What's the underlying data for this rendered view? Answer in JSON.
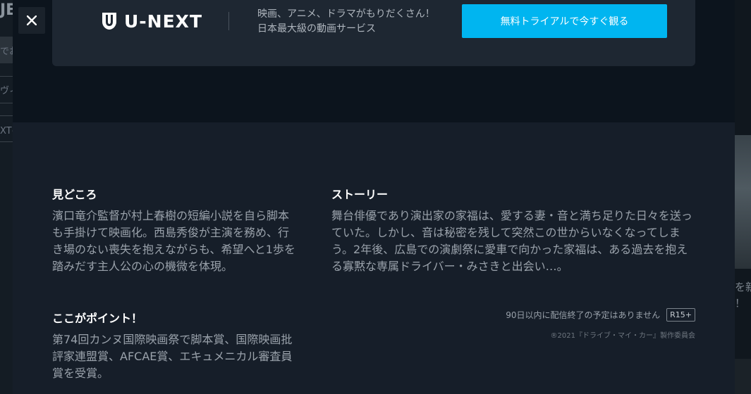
{
  "background": {
    "left_fragments": [
      "JE",
      "でお",
      "ヴィ",
      "XTの"
    ],
    "right_fragments": [
      "を新",
      "！"
    ]
  },
  "modal": {
    "close_label": "✕",
    "banner": {
      "logo_text": "U-NEXT",
      "tagline_line1": "映画、アニメ、ドラマがもりだくさん！",
      "tagline_line2": "日本最大級の動画サービス",
      "cta_label": "無料トライアルで今すぐ観る"
    },
    "highlights": {
      "title": "見どころ",
      "text": "濱口竜介監督が村上春樹の短編小説を自ら脚本も手掛けて映画化。西島秀俊が主演を務め、行き場のない喪失を抱えながらも、希望へと1歩を踏みだす主人公の心の機微を体現。"
    },
    "story": {
      "title": "ストーリー",
      "text": "舞台俳優であり演出家の家福は、愛する妻・音と満ち足りた日々を送っていた。しかし、音は秘密を残して突然この世からいなくなってしまう。2年後、広島での演劇祭に愛車で向かった家福は、ある過去を抱える寡黙な専属ドライバー・みさきと出会い…。"
    },
    "points": {
      "title": "ここがポイント！",
      "text": "第74回カンヌ国際映画祭で脚本賞、国際映画批評家連盟賞、AFCAE賞、エキュメニカル審査員賞を受賞。"
    },
    "availability_text": "90日以内に配信終了の予定はありません",
    "rating_badge": "R15+",
    "copyright": "®2021『ドライブ・マイ・カー』製作委員会"
  },
  "colors": {
    "accent": "#00b5f0",
    "modal_bg": "#161e29",
    "text_muted": "#9aa2ab"
  },
  "icons": {
    "close": "close-icon",
    "logo": "u-next-logo-icon"
  }
}
